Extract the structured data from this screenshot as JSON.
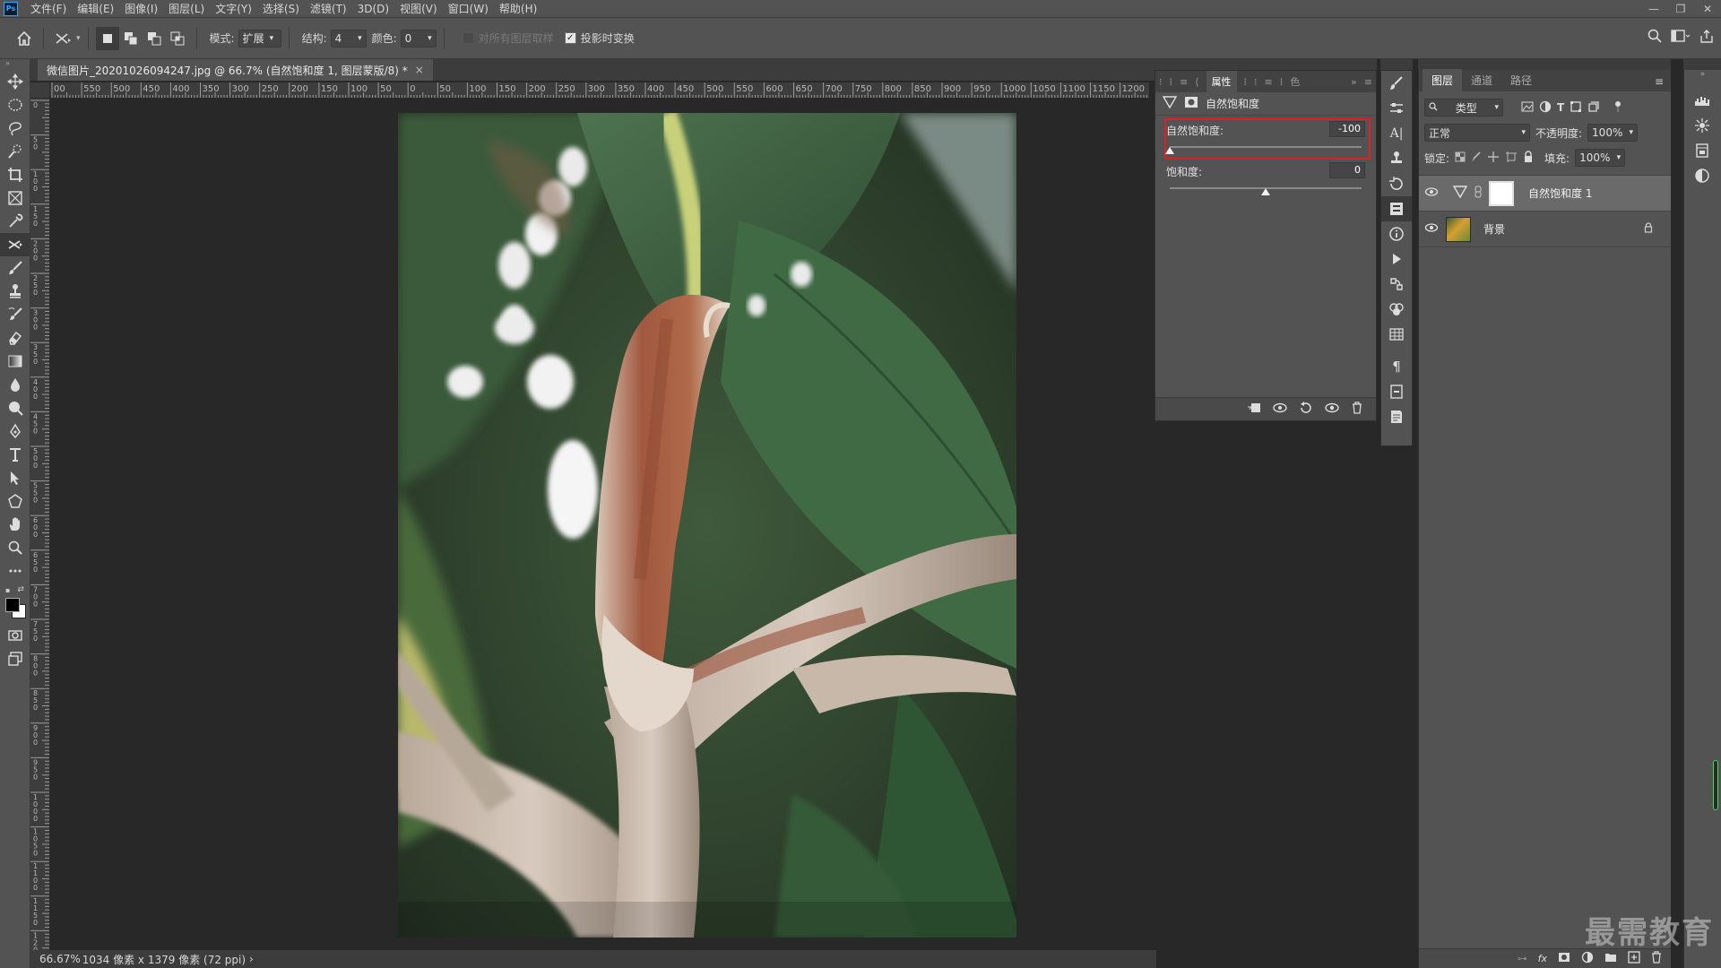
{
  "menubar": {
    "logo": "Ps",
    "items": [
      "文件(F)",
      "编辑(E)",
      "图像(I)",
      "图层(L)",
      "文字(Y)",
      "选择(S)",
      "滤镜(T)",
      "3D(D)",
      "视图(V)",
      "窗口(W)",
      "帮助(H)"
    ],
    "window_controls": [
      "—",
      "❐",
      "✕"
    ]
  },
  "options": {
    "mode_label": "模式:",
    "mode_value": "扩展",
    "structure_label": "结构:",
    "structure_value": "4",
    "color_label": "颜色:",
    "color_value": "0",
    "sample_all_label": "对所有图层取样",
    "transform_on_drop_label": "投影时变换"
  },
  "document": {
    "tab_title": "微信图片_20201026094247.jpg @ 66.7% (自然饱和度 1, 图层蒙版/8) *",
    "close": "×"
  },
  "ruler": {
    "top_labels": [
      "00",
      "550",
      "500",
      "450",
      "400",
      "350",
      "300",
      "250",
      "200",
      "150",
      "100",
      "50",
      "0",
      "50",
      "100",
      "150",
      "200",
      "250",
      "300",
      "350",
      "400",
      "450",
      "500",
      "550",
      "600",
      "650",
      "700",
      "750",
      "800",
      "850",
      "900",
      "950",
      "1000",
      "1050",
      "1100",
      "1150",
      "1200",
      "1"
    ],
    "left_labels": [
      "0",
      "5 0",
      "1 0 0",
      "1 5 0",
      "2 0 0",
      "2 5 0",
      "3 0 0",
      "3 5 0",
      "4 0 0",
      "4 5 0",
      "5 0 0",
      "5 5 0",
      "6 0 0",
      "6 5 0",
      "7 0 0",
      "7 5 0",
      "8 0 0",
      "8 5 0",
      "9 0 0",
      "9 5 0",
      "1 0 0 0",
      "1 0 5 0",
      "1 1 0 0",
      "1 1 5 0",
      "1 2 0 0"
    ]
  },
  "status": {
    "zoom": "66.67%",
    "info": "1034 像素 x 1379 像素 (72 ppi)",
    "arrow": "›"
  },
  "properties": {
    "tabs": [
      "属性",
      "色"
    ],
    "adjustment_name": "自然饱和度",
    "vibrance_label": "自然饱和度:",
    "vibrance_value": "-100",
    "vibrance_level": -100,
    "saturation_label": "饱和度:",
    "saturation_value": "0",
    "saturation_level": 0
  },
  "layers": {
    "tabs": [
      "图层",
      "通道",
      "路径"
    ],
    "filter_label": "类型",
    "blend_mode": "正常",
    "opacity_label": "不透明度:",
    "opacity_value": "100%",
    "lock_label": "锁定:",
    "fill_label": "填充:",
    "fill_value": "100%",
    "items": [
      {
        "name": "自然饱和度 1"
      },
      {
        "name": "背景"
      }
    ],
    "footer_icons": [
      "link-icon",
      "fx-icon",
      "mask-icon",
      "adjustment-icon",
      "folder-icon",
      "new-layer-icon",
      "trash-icon"
    ]
  },
  "watermark": "最需教育",
  "colors": {
    "highlight": "#e02020",
    "panel_bg": "#535353",
    "canvas_bg": "#282828"
  }
}
